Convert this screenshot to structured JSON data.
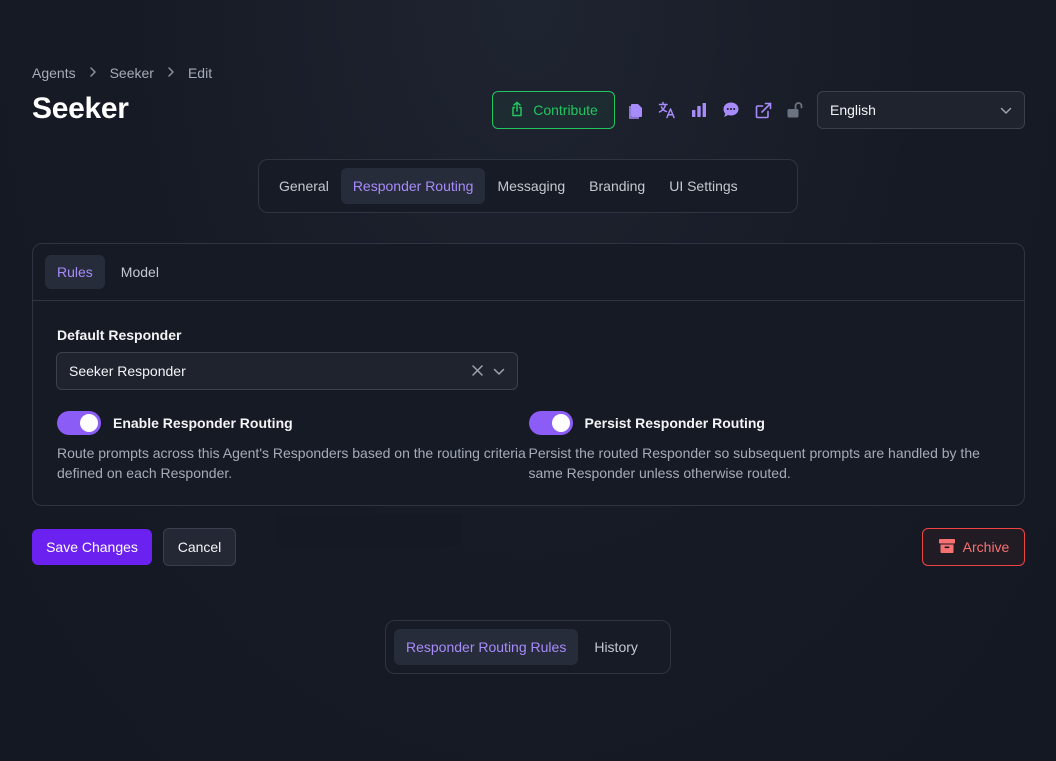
{
  "breadcrumb": [
    "Agents",
    "Seeker",
    "Edit"
  ],
  "page_title": "Seeker",
  "header": {
    "contribute_label": "Contribute",
    "icons": [
      "copy-icon",
      "translate-icon",
      "bar-chart-icon",
      "chat-bubble-icon",
      "external-link-icon",
      "unlock-icon"
    ],
    "language_value": "English"
  },
  "main_tabs": [
    "General",
    "Responder Routing",
    "Messaging",
    "Branding",
    "UI Settings"
  ],
  "main_tabs_active": "Responder Routing",
  "card": {
    "tabs": [
      "Rules",
      "Model"
    ],
    "active_tab": "Rules",
    "default_responder_label": "Default Responder",
    "default_responder_value": "Seeker Responder",
    "enable_routing": {
      "label": "Enable Responder Routing",
      "enabled": true,
      "description": "Route prompts across this Agent's Responders based on the routing criteria defined on each Responder."
    },
    "persist_routing": {
      "label": "Persist Responder Routing",
      "enabled": true,
      "description": "Persist the routed Responder so subsequent prompts are handled by the same Responder unless otherwise routed."
    }
  },
  "buttons": {
    "save": "Save Changes",
    "cancel": "Cancel",
    "archive": "Archive"
  },
  "bottom_tabs": [
    "Responder Routing Rules",
    "History"
  ],
  "bottom_tabs_active": "Responder Routing Rules",
  "colors": {
    "accent": "#8b5cf6",
    "primary_button": "#6b21f0",
    "success": "#22c55e",
    "danger": "#ef4444"
  }
}
